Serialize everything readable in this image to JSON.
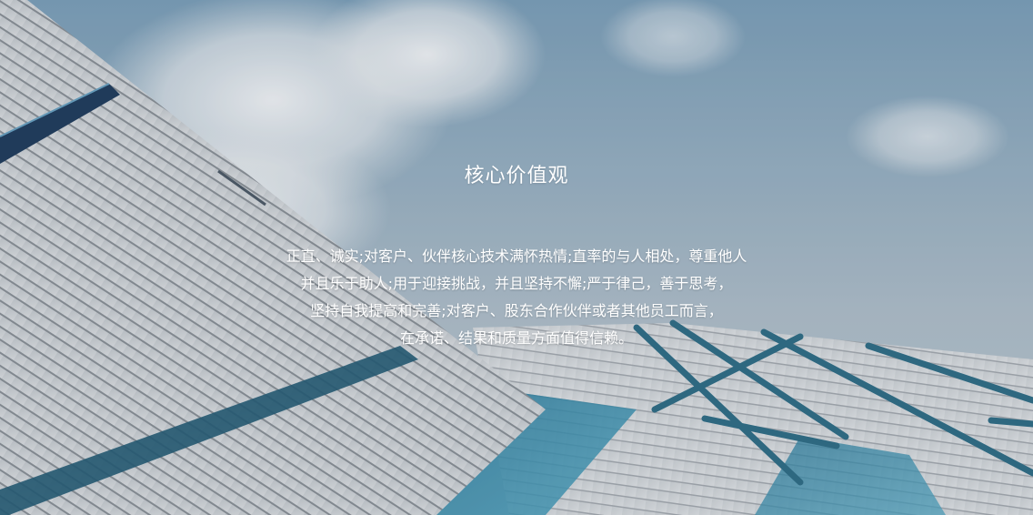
{
  "hero": {
    "title": "核心价值观",
    "lines": [
      "正直、诚实;对客户、伙伴核心技术满怀热情;直率的与人相处，尊重他人",
      "并且乐于助人;用于迎接挑战，并且坚持不懈;严于律己，善于思考，",
      "坚持自我提高和完善;对客户、股东合作伙伴或者其他员工而言，",
      "在承诺、结果和质量方面值得信赖。"
    ]
  }
}
